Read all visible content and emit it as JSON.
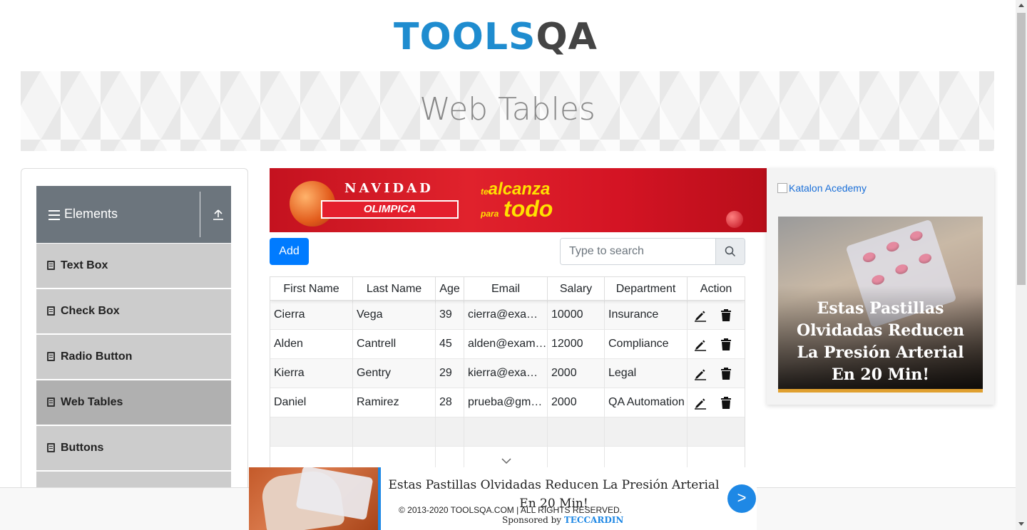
{
  "logo": {
    "text_main": "TOOLS",
    "text_qa": "QA"
  },
  "banner": {
    "title": "Web Tables"
  },
  "sidebar": {
    "group_label": "Elements",
    "items": [
      {
        "label": "Text Box"
      },
      {
        "label": "Check Box"
      },
      {
        "label": "Radio Button"
      },
      {
        "label": "Web Tables",
        "active": true
      },
      {
        "label": "Buttons"
      }
    ]
  },
  "ad_top": {
    "headline": "NAVIDAD",
    "brand": "OLIMPICA",
    "tagline_small": "te",
    "tagline": "alcanza",
    "tagline_small2": "para",
    "tagline2": "todo"
  },
  "toolbar": {
    "add_label": "Add",
    "search_placeholder": "Type to search"
  },
  "table": {
    "columns": [
      "First Name",
      "Last Name",
      "Age",
      "Email",
      "Salary",
      "Department",
      "Action"
    ],
    "rows": [
      [
        "Cierra",
        "Vega",
        "39",
        "cierra@example.com",
        "10000",
        "Insurance"
      ],
      [
        "Alden",
        "Cantrell",
        "45",
        "alden@example.com",
        "12000",
        "Compliance"
      ],
      [
        "Kierra",
        "Gentry",
        "29",
        "kierra@example.com",
        "2000",
        "Legal"
      ],
      [
        "Daniel",
        "Ramirez",
        "28",
        "prueba@gmail.com",
        "2000",
        "QA Automation"
      ]
    ]
  },
  "ad_right": {
    "alt_text": "Katalon Acedemy",
    "headline": "Estas Pastillas Olvidadas Reducen La Presión Arterial En 20 Min!"
  },
  "ad_bottom": {
    "headline": "Estas Pastillas Olvidadas Reducen La Presión Arterial En 20 Min!",
    "button": ">"
  },
  "footer": {
    "copyright": "© 2013-2020 TOOLSQA.COM | ALL RIGHTS RESERVED.",
    "sponsored_prefix": "Sponsored by ",
    "sponsor": "TECCARDIN"
  },
  "colors": {
    "brand_blue": "#1f8ccf",
    "primary": "#007bff",
    "sidebar_header": "#6c757d",
    "sidebar_item": "#cccccc"
  }
}
